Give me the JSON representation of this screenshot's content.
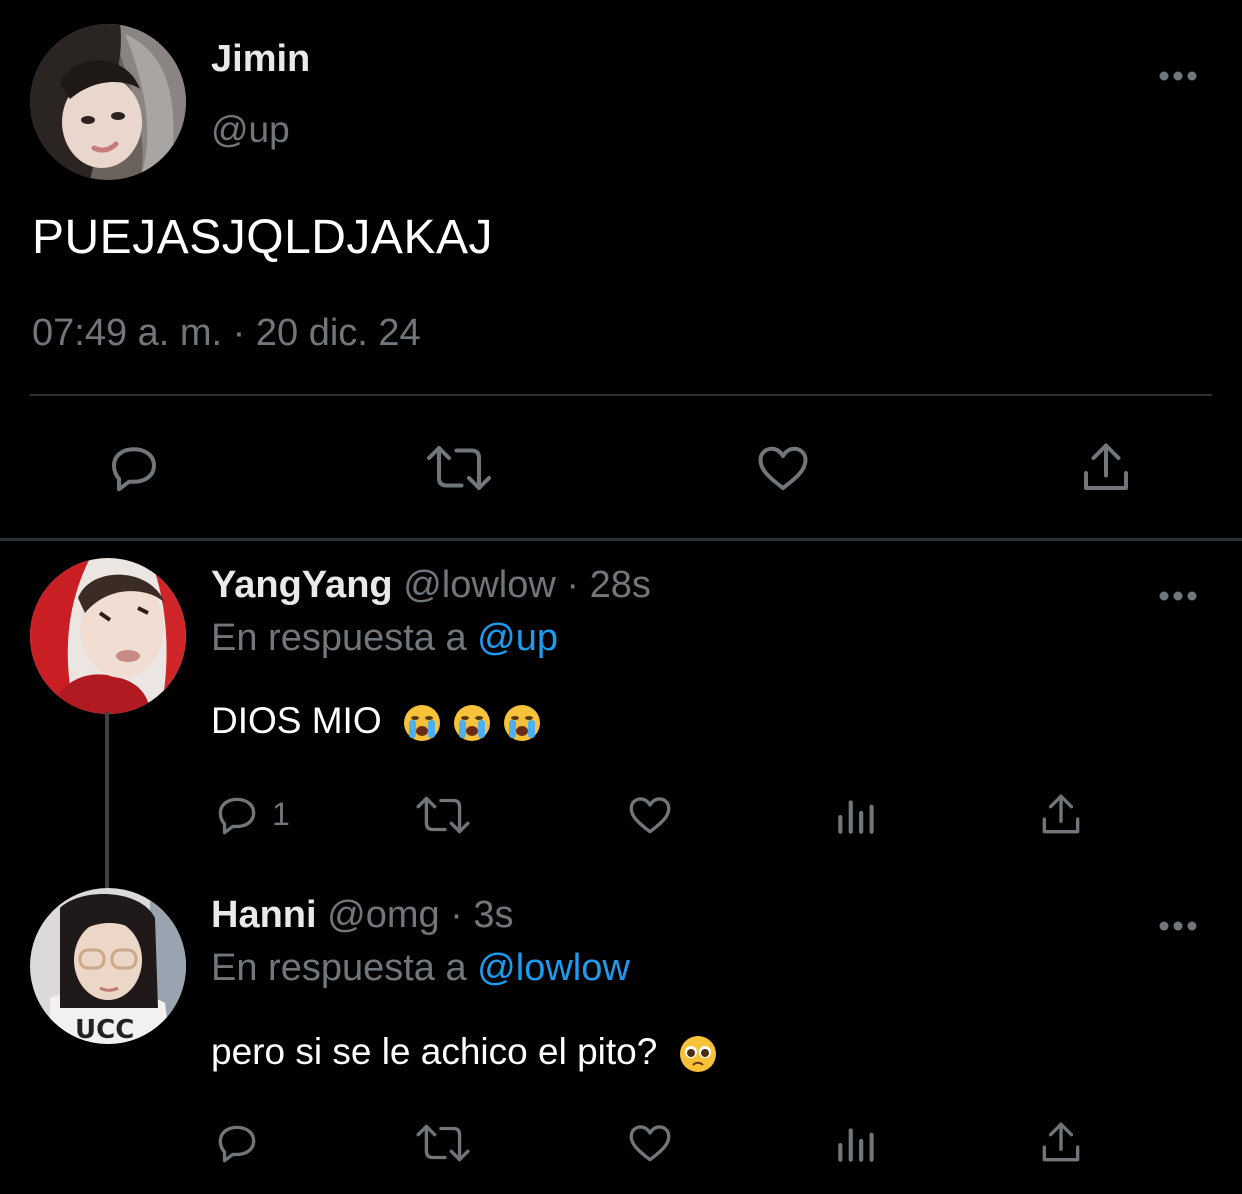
{
  "main_tweet": {
    "name": "Jimin",
    "handle": "@up",
    "text": "PUEJASJQLDJAKAJ",
    "timestamp": "07:49 a. m. · 20 dic. 24",
    "more_icon": "more-horizontal-icon",
    "actions": [
      "reply-icon",
      "retweet-icon",
      "like-icon",
      "share-icon"
    ]
  },
  "replies": [
    {
      "name": "YangYang",
      "handle": "@lowlow",
      "sep_time": " · 28s",
      "reply_prefix": "En respuesta a ",
      "reply_to": "@up",
      "text": "DIOS MIO",
      "emojis": [
        "loudly-crying-face",
        "loudly-crying-face",
        "loudly-crying-face"
      ],
      "reply_count": "1",
      "actions": [
        "reply-icon",
        "retweet-icon",
        "like-icon",
        "views-icon",
        "share-icon"
      ]
    },
    {
      "name": "Hanni",
      "handle": "@omg",
      "sep_time": " · 3s",
      "reply_prefix": "En respuesta a ",
      "reply_to": "@lowlow",
      "text": "pero si se le achico el pito?",
      "emojis": [
        "pleading-face"
      ],
      "reply_count": "",
      "actions": [
        "reply-icon",
        "retweet-icon",
        "like-icon",
        "views-icon",
        "share-icon"
      ]
    }
  ],
  "colors": {
    "background": "#000000",
    "primary_text": "#e7e9ea",
    "secondary_text": "#71767b",
    "mention": "#1d9bf0",
    "divider": "#2f3336"
  }
}
